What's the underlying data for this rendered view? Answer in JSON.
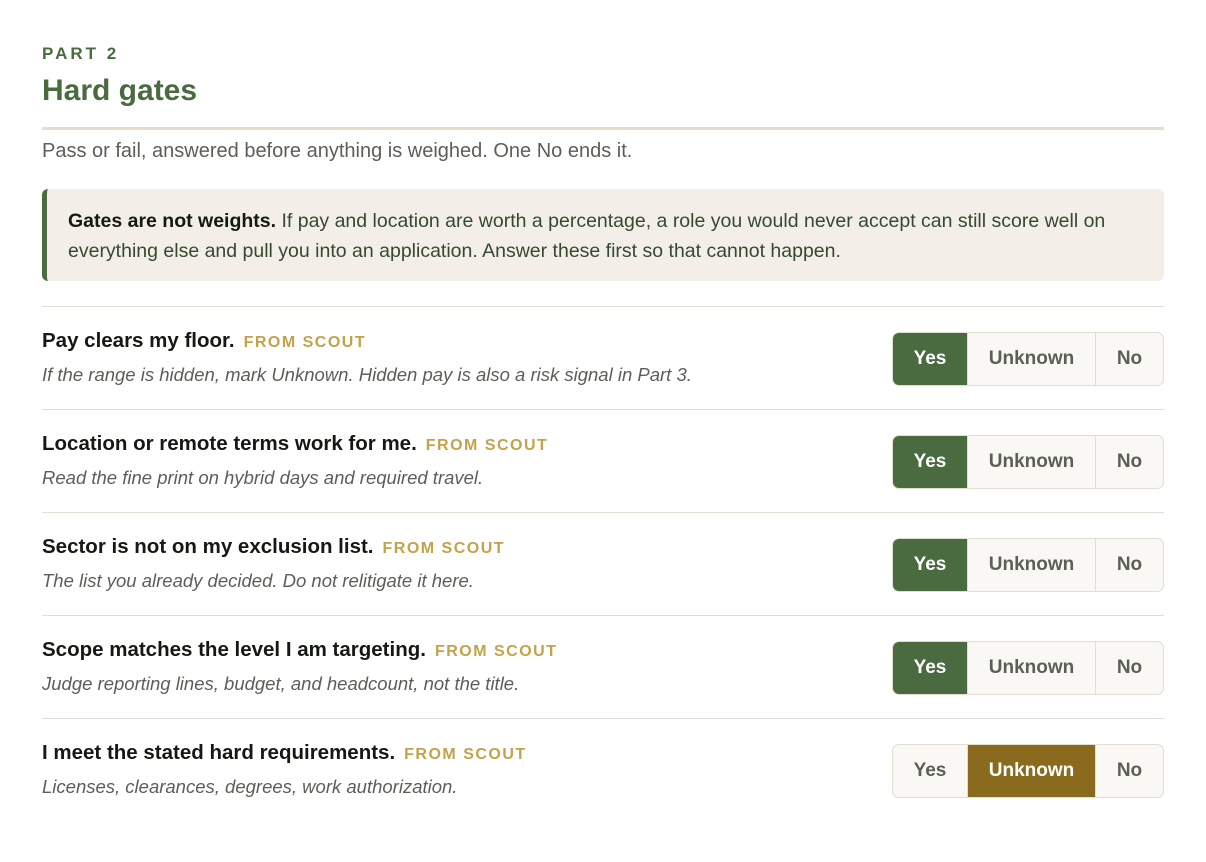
{
  "section": {
    "eyebrow": "PART 2",
    "title": "Hard gates",
    "intro": "Pass or fail, answered before anything is weighed. One No ends it."
  },
  "callout": {
    "lead": "Gates are not weights.",
    "body": " If pay and location are worth a percentage, a role you would never accept can still score well on everything else and pull you into an application. Answer these first so that cannot happen."
  },
  "options": {
    "yes": "Yes",
    "unknown": "Unknown",
    "no": "No"
  },
  "colors": {
    "accent": "#4a6a40",
    "unknown_selected": "#8a6a1c",
    "source_tag": "#c3a24a"
  },
  "gates": [
    {
      "question": "Pay clears my floor.",
      "source": "FROM SCOUT",
      "hint": "If the range is hidden, mark Unknown. Hidden pay is also a risk signal in Part 3.",
      "selected": "yes"
    },
    {
      "question": "Location or remote terms work for me.",
      "source": "FROM SCOUT",
      "hint": "Read the fine print on hybrid days and required travel.",
      "selected": "yes"
    },
    {
      "question": "Sector is not on my exclusion list.",
      "source": "FROM SCOUT",
      "hint": "The list you already decided. Do not relitigate it here.",
      "selected": "yes"
    },
    {
      "question": "Scope matches the level I am targeting.",
      "source": "FROM SCOUT",
      "hint": "Judge reporting lines, budget, and headcount, not the title.",
      "selected": "yes"
    },
    {
      "question": "I meet the stated hard requirements.",
      "source": "FROM SCOUT",
      "hint": "Licenses, clearances, degrees, work authorization.",
      "selected": "unknown"
    }
  ]
}
